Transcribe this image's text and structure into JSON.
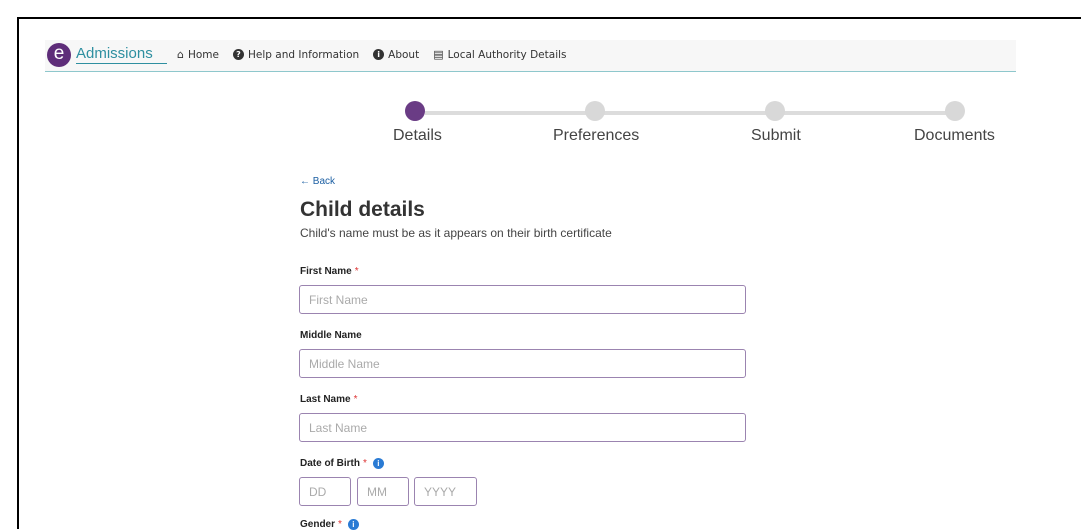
{
  "nav": {
    "logo_letter": "e",
    "brand": "Admissions",
    "links": [
      {
        "icon": "home-icon",
        "label": "Home"
      },
      {
        "icon": "help-icon",
        "label": "Help and Information"
      },
      {
        "icon": "info-icon",
        "label": "About"
      },
      {
        "icon": "building-icon",
        "label": "Local Authority Details"
      }
    ]
  },
  "stepper": {
    "steps": [
      "Details",
      "Preferences",
      "Submit",
      "Documents"
    ],
    "active_index": 0,
    "active_color": "#6a3c85"
  },
  "form": {
    "back_label": "Back",
    "title": "Child details",
    "subtitle": "Child's name must be as it appears on their birth certificate",
    "fields": {
      "first_name": {
        "label": "First Name",
        "required": "*",
        "placeholder": "First Name"
      },
      "middle_name": {
        "label": "Middle Name",
        "placeholder": "Middle Name"
      },
      "last_name": {
        "label": "Last Name",
        "required": "*",
        "placeholder": "Last Name"
      },
      "dob": {
        "label": "Date of Birth",
        "required": "*",
        "day": "DD",
        "month": "MM",
        "year": "YYYY"
      },
      "gender": {
        "label": "Gender",
        "required": "*"
      }
    }
  }
}
